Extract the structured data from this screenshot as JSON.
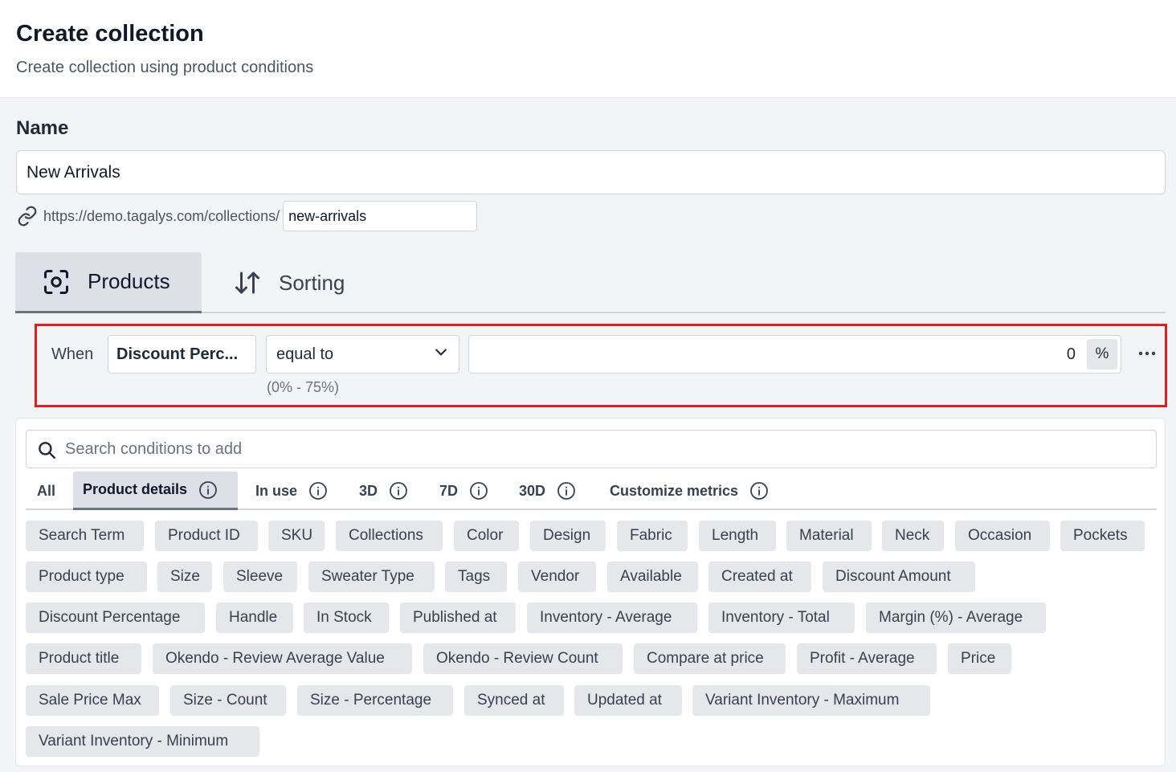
{
  "header": {
    "title": "Create collection",
    "subtitle": "Create collection using product conditions"
  },
  "form": {
    "name_label": "Name",
    "name_value": "New Arrivals",
    "url_prefix": "https://demo.tagalys.com/collections/",
    "slug_value": "new-arrivals"
  },
  "tabs": [
    {
      "label": "Products",
      "icon": "scan-icon",
      "active": true
    },
    {
      "label": "Sorting",
      "icon": "sort-arrows-icon",
      "active": false
    }
  ],
  "condition": {
    "when_label": "When",
    "field": "Discount Perc...",
    "operator": "equal to",
    "range_hint": "(0% - 75%)",
    "value": "0",
    "unit": "%"
  },
  "conditions_panel": {
    "search_placeholder": "Search conditions to add",
    "filter_tabs": [
      {
        "label": "All",
        "info": false,
        "active": false
      },
      {
        "label": "Product details",
        "info": true,
        "active": true
      },
      {
        "label": "In use",
        "info": true,
        "active": false
      },
      {
        "label": "3D",
        "info": true,
        "active": false
      },
      {
        "label": "7D",
        "info": true,
        "active": false
      },
      {
        "label": "30D",
        "info": true,
        "active": false
      },
      {
        "label": "Customize metrics",
        "info": true,
        "active": false
      }
    ],
    "chips": [
      [
        "Search Term",
        "Product ID",
        "SKU",
        "Collections",
        "Color",
        "Design",
        "Fabric",
        "Length",
        "Material",
        "Neck",
        "Occasion",
        "Pockets"
      ],
      [
        "Product type",
        "Size",
        "Sleeve",
        "Sweater Type",
        "Tags",
        "Vendor",
        "Available",
        "Created at",
        "Discount Amount"
      ],
      [
        "Discount Percentage",
        "Handle",
        "In Stock",
        "Published at",
        "Inventory - Average",
        "Inventory - Total",
        "Margin (%) - Average"
      ],
      [
        "Product title",
        "Okendo - Review Average Value",
        "Okendo - Review Count",
        "Compare at price",
        "Profit - Average",
        "Price"
      ],
      [
        "Sale Price Max",
        "Size - Count",
        "Size - Percentage",
        "Synced at",
        "Updated at",
        "Variant Inventory - Maximum"
      ],
      [
        "Variant Inventory - Minimum"
      ]
    ]
  }
}
